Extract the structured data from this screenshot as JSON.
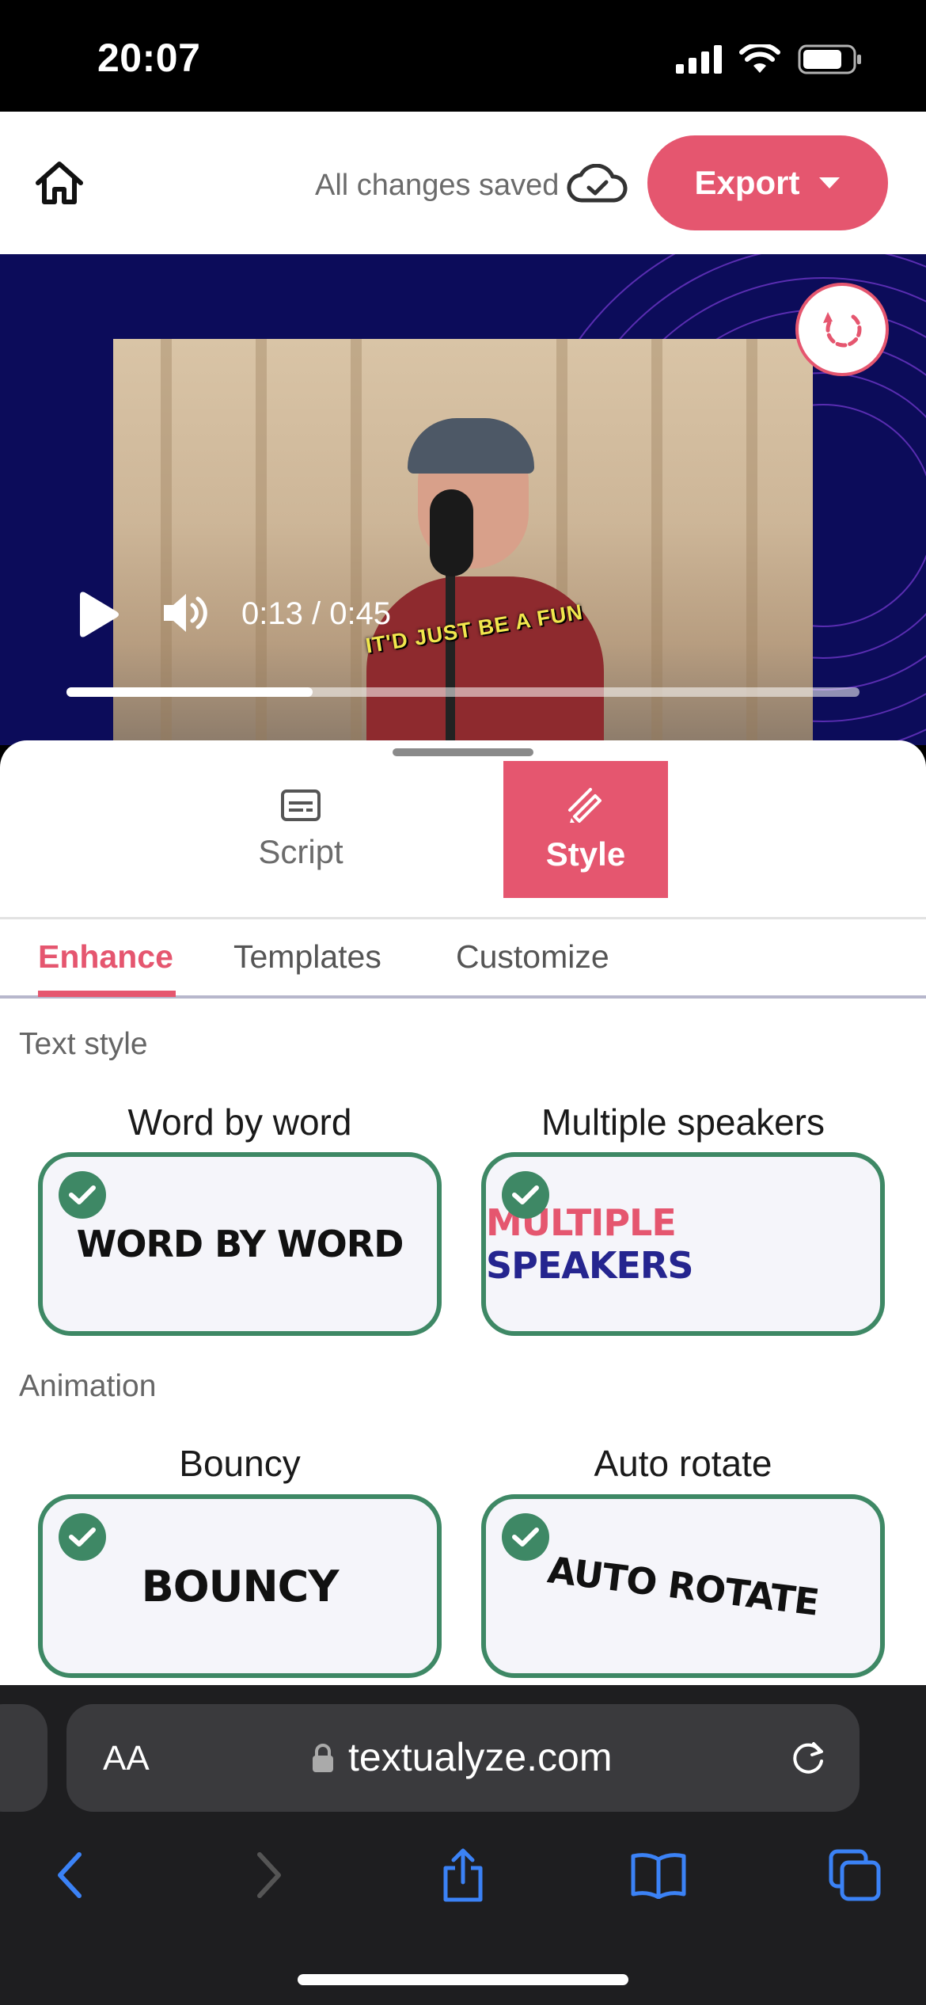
{
  "status_bar": {
    "time": "20:07"
  },
  "header": {
    "save_status": "All changes saved",
    "export_label": "Export"
  },
  "video": {
    "time_display": "0:13 / 0:45",
    "caption": "IT'D JUST BE A FUN",
    "progress": 0.31
  },
  "mode_tabs": [
    {
      "label": "Script",
      "active": false
    },
    {
      "label": "Style",
      "active": true
    }
  ],
  "sub_tabs": [
    {
      "label": "Enhance",
      "active": true
    },
    {
      "label": "Templates",
      "active": false
    },
    {
      "label": "Customize",
      "active": false
    }
  ],
  "text_style": {
    "label": "Text style",
    "options": [
      {
        "title": "Word by word",
        "preview": "WORD BY WORD",
        "selected": true
      },
      {
        "title": "Multiple speakers",
        "preview_part1": "MULTIPLE",
        "preview_part2": "SPEAKERS",
        "selected": true
      }
    ]
  },
  "animation": {
    "label": "Animation",
    "options": [
      {
        "title": "Bouncy",
        "preview": "BOUNCY",
        "selected": true
      },
      {
        "title": "Auto rotate",
        "preview": "AUTO ROTATE",
        "selected": true
      }
    ]
  },
  "browser": {
    "aa_label": "AA",
    "url": "textualyze.com"
  },
  "colors": {
    "accent": "#e5566f",
    "selected_border": "#3e8865",
    "speaker_two": "#25258f",
    "video_bg": "#0c0c5a"
  }
}
